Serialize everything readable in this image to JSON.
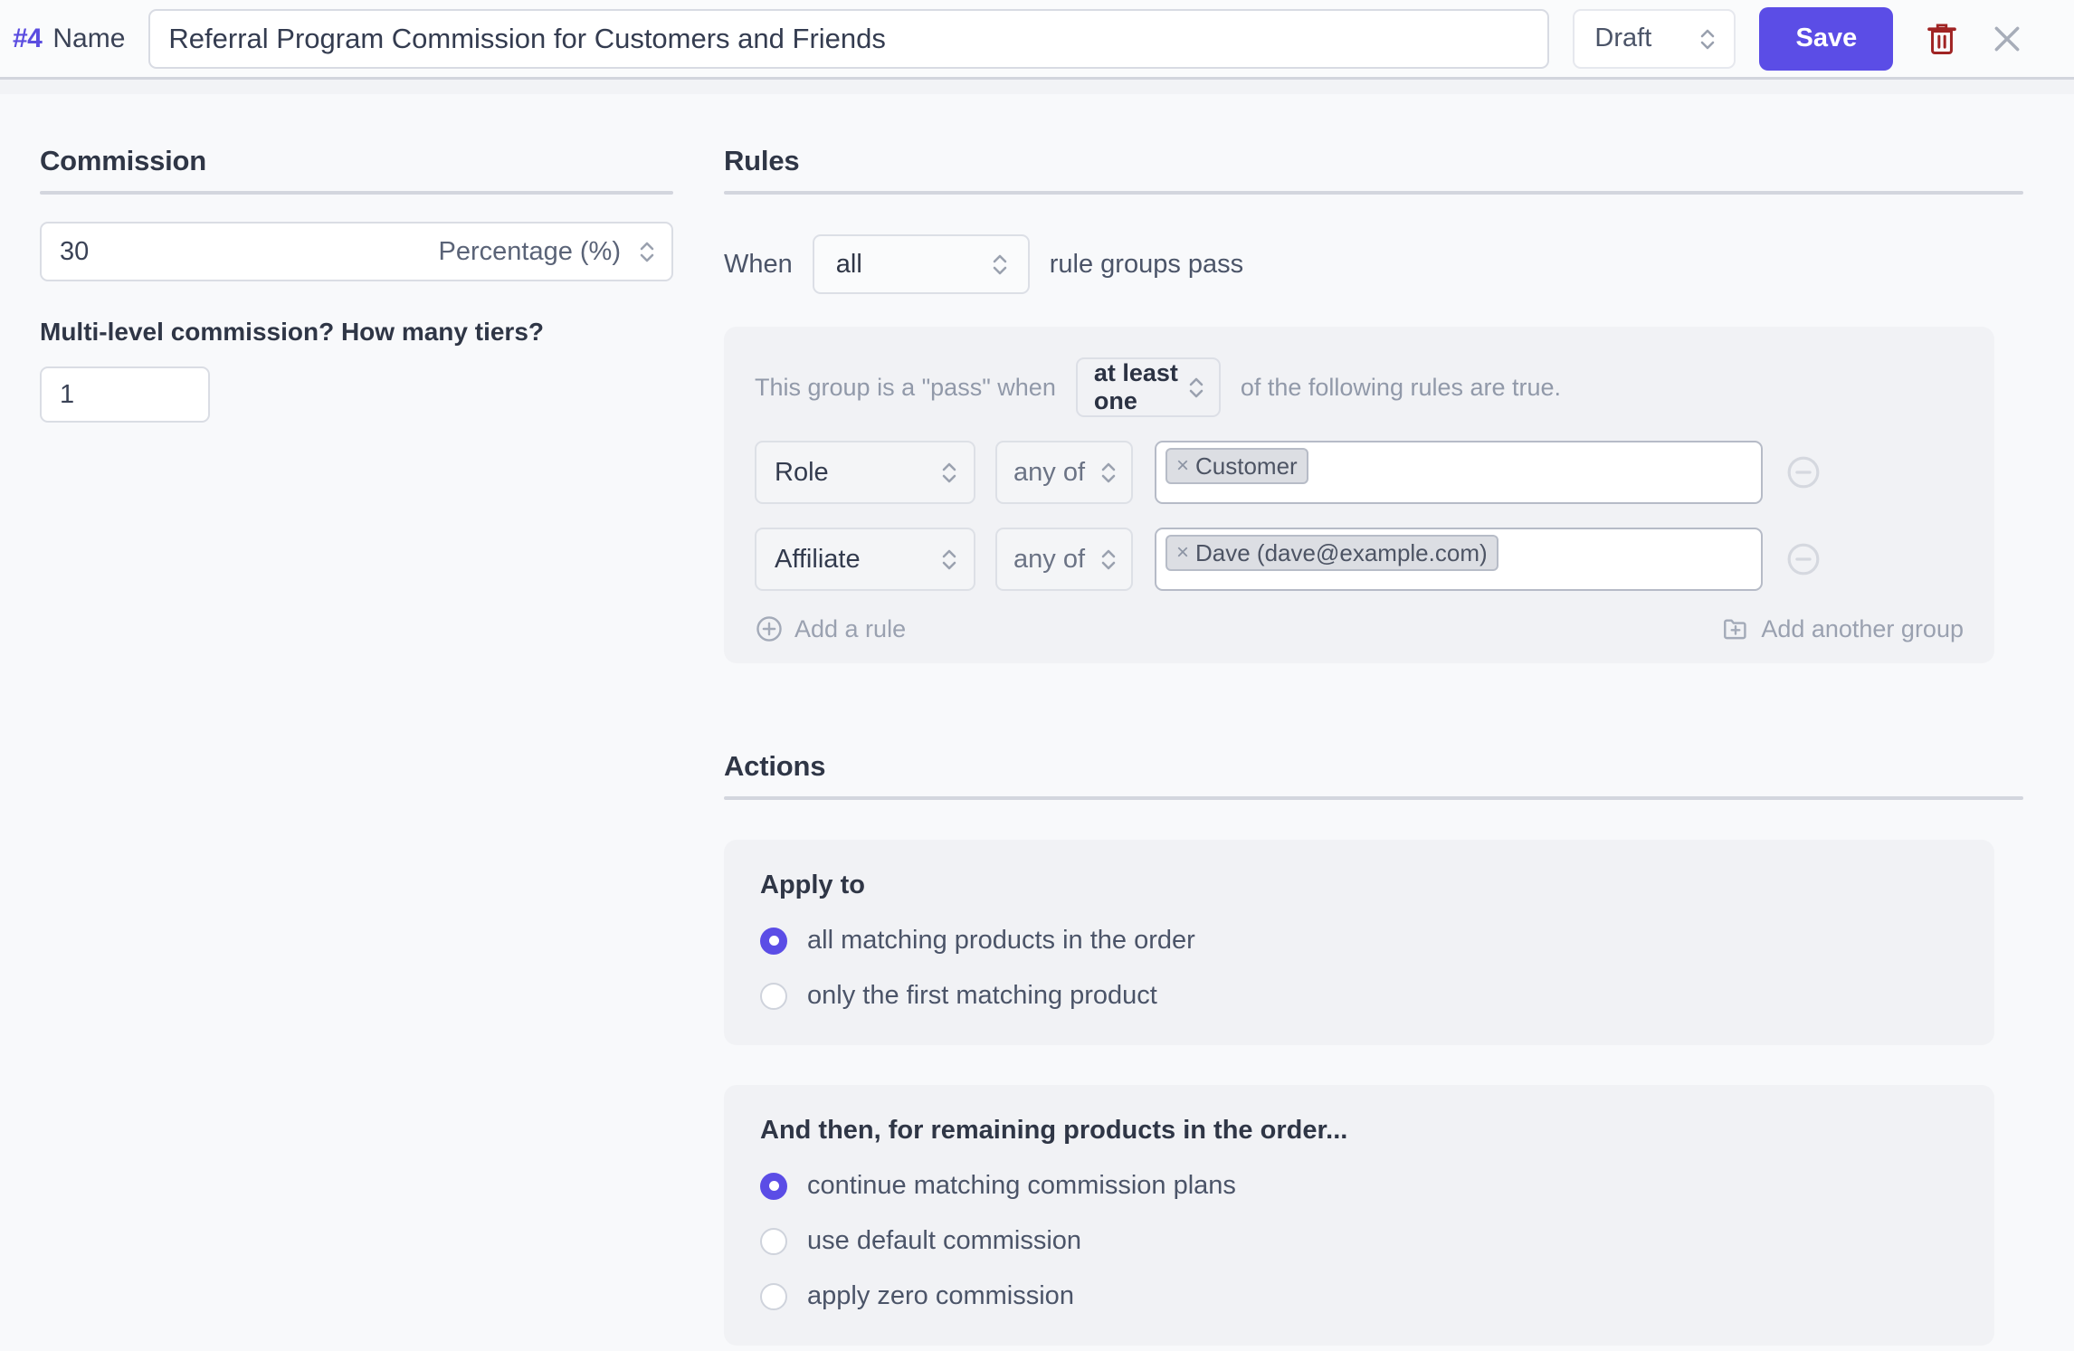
{
  "header": {
    "record_id": "#4",
    "name_label": "Name",
    "name_value": "Referral Program Commission for Customers and Friends",
    "name_placeholder": "Name",
    "status_value": "Draft",
    "save_label": "Save",
    "delete_icon": "trash-icon",
    "close_icon": "close-icon",
    "accent_color": "#5b4de6",
    "delete_color": "#a02424"
  },
  "commission": {
    "title": "Commission",
    "amount_value": "30",
    "unit_value": "Percentage (%)",
    "tiers_question": "Multi-level commission? How many tiers?",
    "tiers_value": "1"
  },
  "rules": {
    "title": "Rules",
    "when_prefix": "When",
    "when_value": "all",
    "when_suffix": "rule groups pass",
    "group": {
      "pass_prefix": "This group is a \"pass\" when",
      "pass_value": "at least one",
      "pass_suffix": "of the following rules are true.",
      "rows": [
        {
          "field": "Role",
          "operator": "any of",
          "tags": [
            "Customer"
          ]
        },
        {
          "field": "Affiliate",
          "operator": "any of",
          "tags": [
            "Dave (dave@example.com)"
          ]
        }
      ],
      "add_rule_label": "Add a rule",
      "add_rule_icon": "circle-plus-icon",
      "add_group_label": "Add another group",
      "add_group_icon": "folder-plus-icon",
      "remove_icon": "circle-minus-icon"
    }
  },
  "actions": {
    "title": "Actions",
    "apply_to": {
      "title": "Apply to",
      "options": [
        {
          "label": "all matching products in the order",
          "checked": true
        },
        {
          "label": "only the first matching product",
          "checked": false
        }
      ]
    },
    "remaining": {
      "title": "And then, for remaining products in the order...",
      "options": [
        {
          "label": "continue matching commission plans",
          "checked": true
        },
        {
          "label": "use default commission",
          "checked": false
        },
        {
          "label": "apply zero commission",
          "checked": false
        }
      ]
    }
  }
}
